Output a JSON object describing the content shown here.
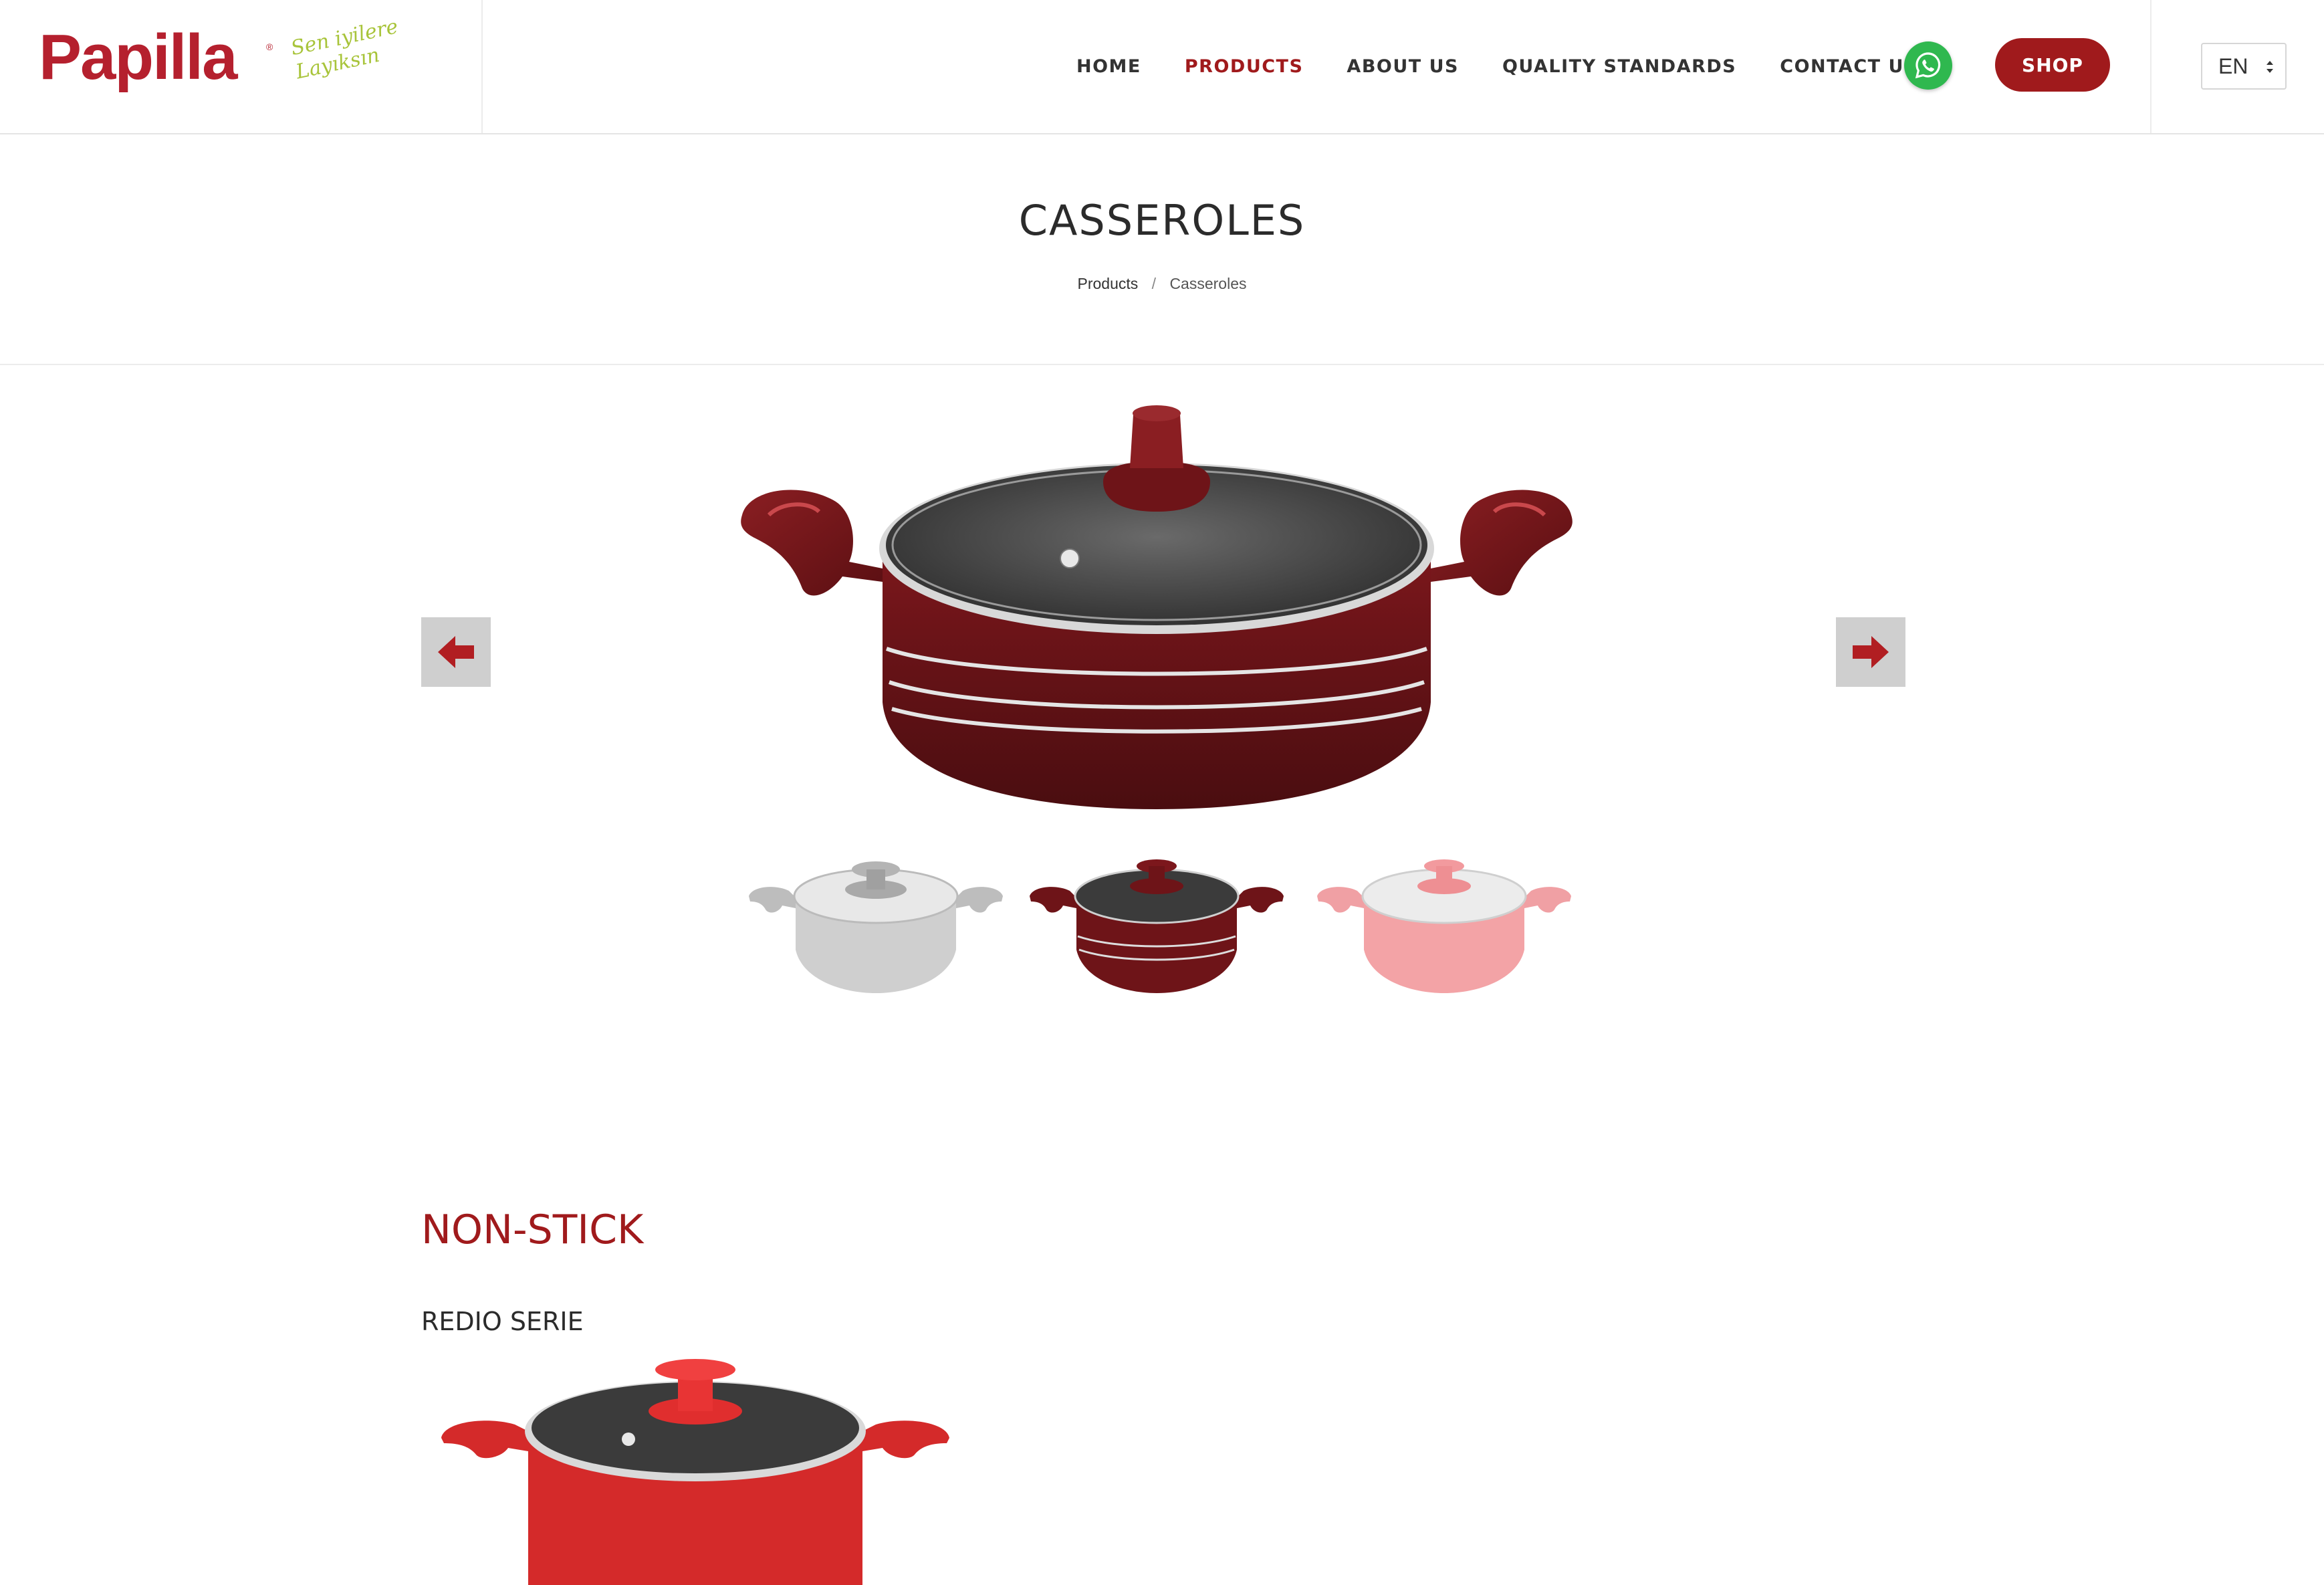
{
  "header": {
    "logo_text": "Papilla",
    "logo_slogan": "Sen iyilere Layıksın",
    "nav": [
      {
        "label": "HOME",
        "active": false
      },
      {
        "label": "PRODUCTS",
        "active": true
      },
      {
        "label": "ABOUT US",
        "active": false
      },
      {
        "label": "QUALITY STANDARDS",
        "active": false
      },
      {
        "label": "CONTACT US",
        "active": false
      }
    ],
    "whatsapp_icon": "whatsapp-icon",
    "shop_label": "SHOP",
    "language": "EN"
  },
  "page": {
    "title": "CASSEROLES",
    "breadcrumb": {
      "parent": "Products",
      "separator": "/",
      "current": "Casseroles"
    }
  },
  "slider": {
    "prev_icon": "arrow-left-icon",
    "next_icon": "arrow-right-icon",
    "thumbnails": [
      {
        "color": "#c9c9c9"
      },
      {
        "color": "#6e1418"
      },
      {
        "color": "#f3a3a6"
      }
    ]
  },
  "section": {
    "title": "NON-STICK",
    "series_title": "REDIO SERIE"
  },
  "colors": {
    "brand_red": "#a01a1c",
    "logo_red": "#b5202e",
    "slogan_green": "#a8c43a",
    "whatsapp_green": "#2fb84f",
    "arrow_bg": "#cfcfcf"
  }
}
